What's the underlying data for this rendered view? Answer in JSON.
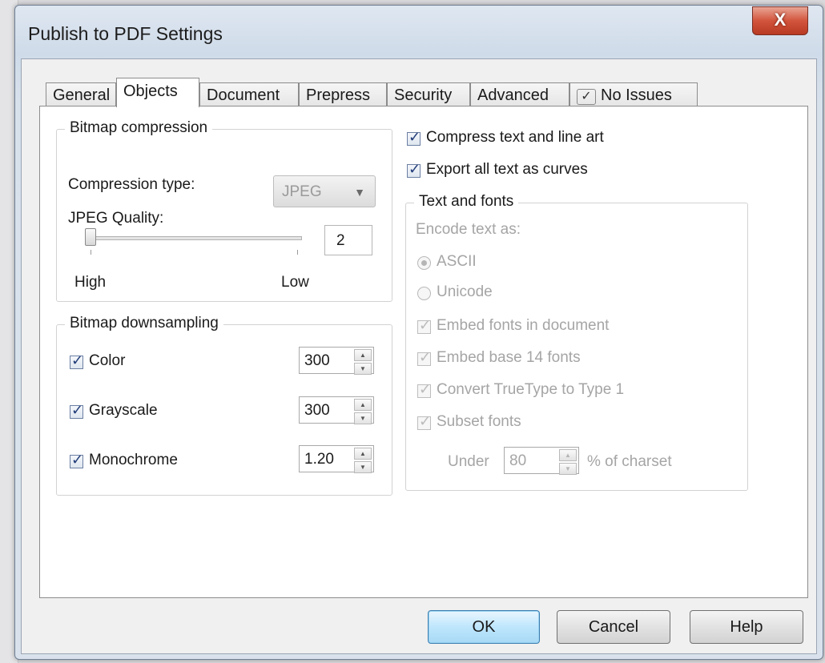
{
  "window": {
    "title": "Publish to PDF Settings",
    "close_glyph": "X"
  },
  "tabs": [
    {
      "label": "General"
    },
    {
      "label": "Objects"
    },
    {
      "label": "Document"
    },
    {
      "label": "Prepress"
    },
    {
      "label": "Security"
    },
    {
      "label": "Advanced"
    },
    {
      "label": "No Issues",
      "icon": "checkmark-icon"
    }
  ],
  "active_tab": "Objects",
  "bitmap_compression": {
    "title": "Bitmap compression",
    "compression_type_label": "Compression type:",
    "compression_type_value": "JPEG",
    "jpeg_quality_label": "JPEG Quality:",
    "jpeg_quality_value": "2",
    "slider_level": 0.02,
    "high_label": "High",
    "low_label": "Low"
  },
  "bitmap_downsampling": {
    "title": "Bitmap downsampling",
    "items": [
      {
        "label": "Color",
        "checked": true,
        "value": "300"
      },
      {
        "label": "Grayscale",
        "checked": true,
        "value": "300"
      },
      {
        "label": "Monochrome",
        "checked": true,
        "value": "1.20"
      }
    ]
  },
  "options": {
    "compress_text": {
      "label": "Compress text and line art",
      "checked": true
    },
    "export_curves": {
      "label": "Export all text as curves",
      "checked": true
    }
  },
  "text_fonts": {
    "title": "Text and fonts",
    "encode_label": "Encode text as:",
    "ascii_label": "ASCII",
    "unicode_label": "Unicode",
    "embed_fonts_label": "Embed fonts in document",
    "embed_base_label": "Embed base 14 fonts",
    "convert_truetype_label": "Convert TrueType to Type 1",
    "subset_fonts_label": "Subset fonts",
    "under_label": "Under",
    "under_value": "80",
    "charset_label": "% of charset"
  },
  "buttons": {
    "ok": "OK",
    "cancel": "Cancel",
    "help": "Help"
  },
  "colors": {
    "titlebar": "#cfdbe9",
    "close": "#d2543c",
    "default_button": "#bee6fd"
  }
}
